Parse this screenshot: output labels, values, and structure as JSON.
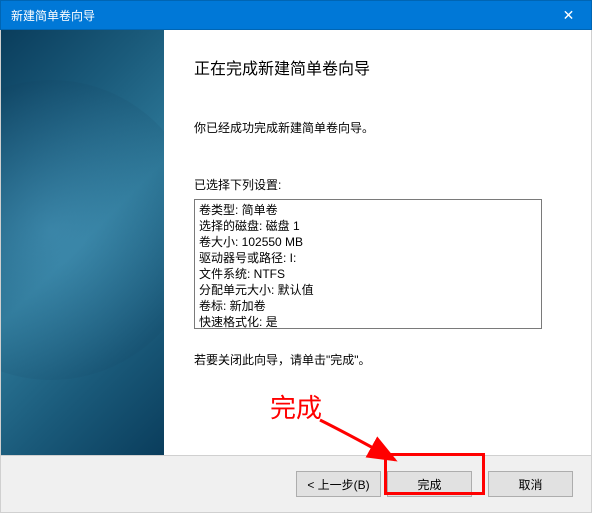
{
  "titlebar": {
    "title": "新建简单卷向导"
  },
  "content": {
    "heading": "正在完成新建简单卷向导",
    "description": "你已经成功完成新建简单卷向导。",
    "settings_label": "已选择下列设置:",
    "settings": [
      "卷类型: 简单卷",
      "选择的磁盘: 磁盘 1",
      "卷大小: 102550 MB",
      "驱动器号或路径: I:",
      "文件系统: NTFS",
      "分配单元大小: 默认值",
      "卷标: 新加卷",
      "快速格式化: 是"
    ],
    "footer_text": "若要关闭此向导，请单击\"完成\"。"
  },
  "buttons": {
    "back": "< 上一步(B)",
    "finish": "完成",
    "cancel": "取消"
  },
  "annotation": {
    "label": "完成"
  }
}
